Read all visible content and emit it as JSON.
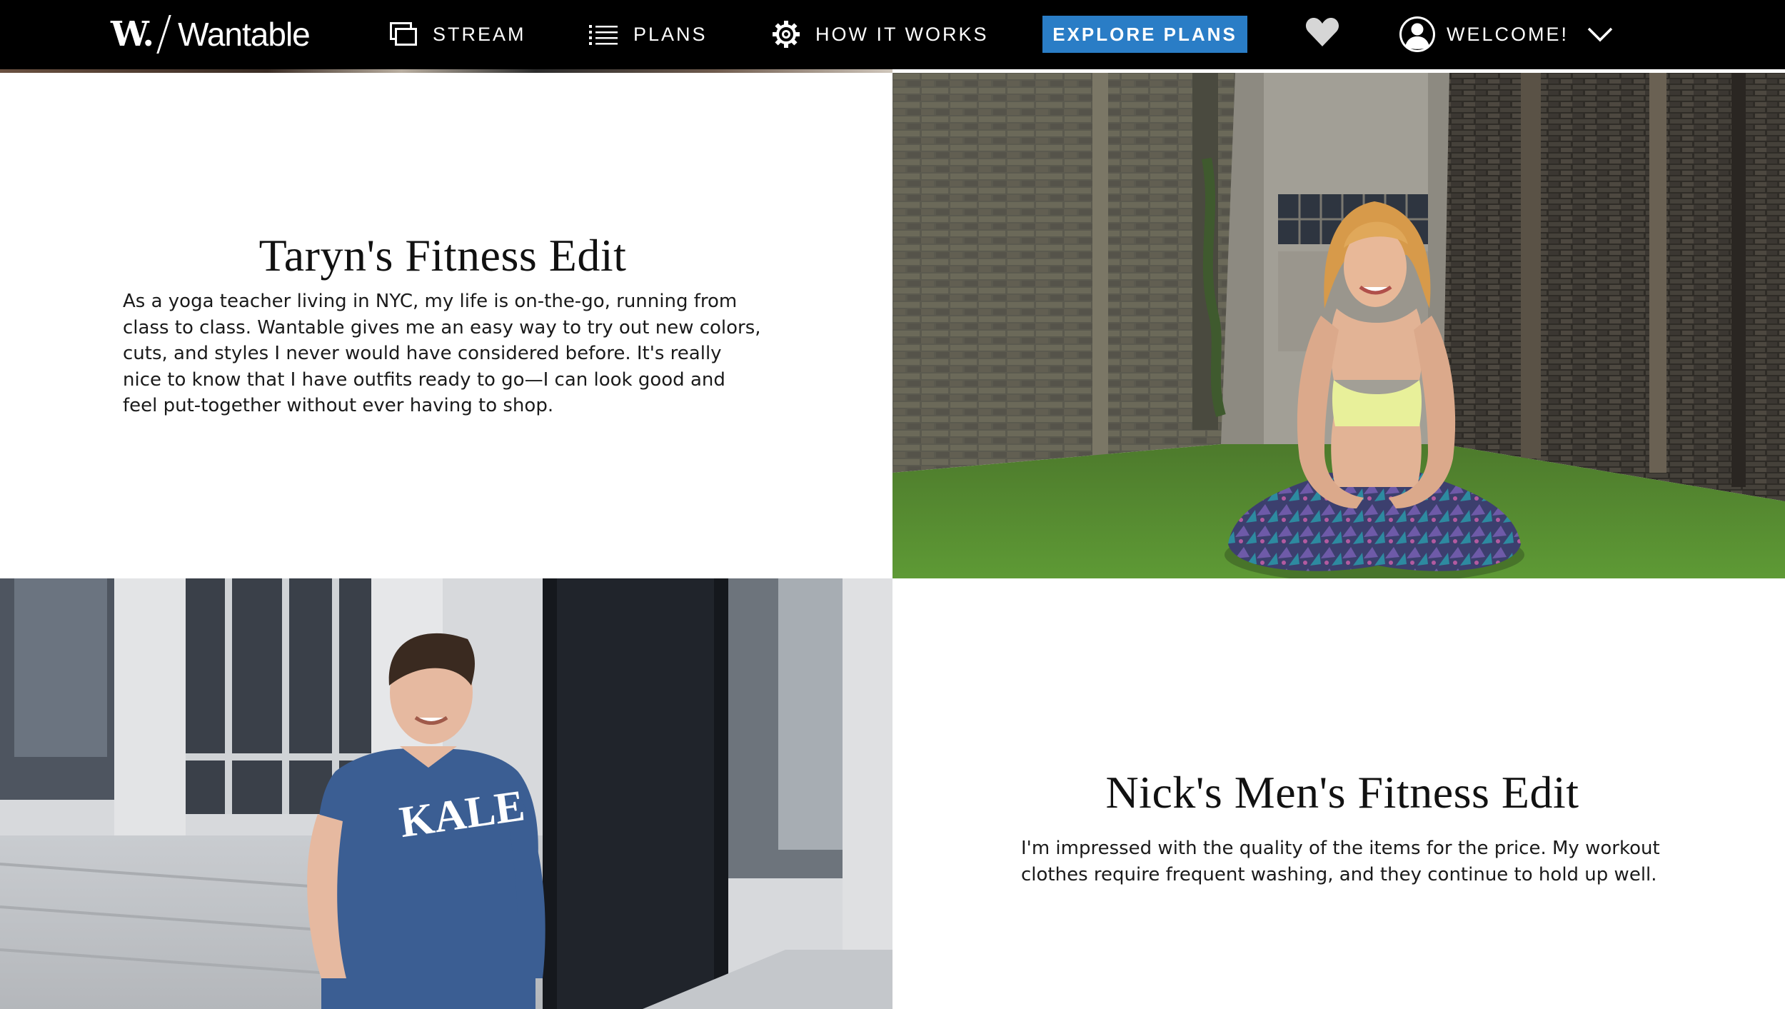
{
  "nav": {
    "logo_mark": "W.",
    "logo_word": "Wantable",
    "stream_label": "STREAM",
    "plans_label": "PLANS",
    "how_label": "HOW IT WORKS",
    "cta_label": "EXPLORE PLANS",
    "welcome_label": "WELCOME!",
    "icons": [
      "stream-icon",
      "list-icon",
      "gear-icon",
      "heart-icon",
      "user-icon",
      "chevron-down-icon"
    ]
  },
  "edits": [
    {
      "title": "Taryn's Fitness Edit",
      "body": "As a yoga teacher living in NYC, my life is on-the-go, running from class to class. Wantable gives me an easy way to try out new colors, cuts, and styles I never would have considered before. It's really nice to know that I have outfits ready to go—I can look good and feel put-together without ever having to shop."
    },
    {
      "title": "Nick's Men's Fitness Edit",
      "body": "I'm impressed with the quality of the items for the price. My workout clothes require frequent washing, and they continue to hold up well."
    }
  ],
  "photos": {
    "nick_shirt_text": "KALE"
  },
  "colors": {
    "nav_bg": "#000000",
    "cta_bg": "#2a7dc6"
  }
}
